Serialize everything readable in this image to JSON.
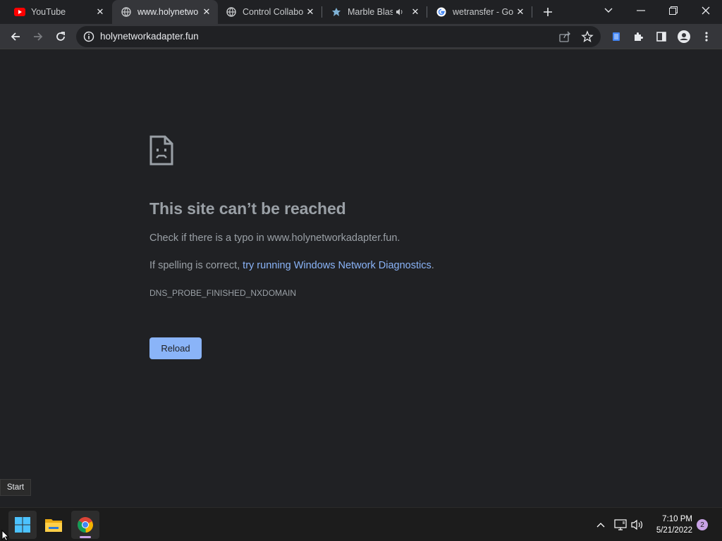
{
  "tabs": [
    {
      "title": "YouTube",
      "favicon": "youtube-icon"
    },
    {
      "title": "www.holynetwo",
      "favicon": "globe-icon"
    },
    {
      "title": "Control Collabo",
      "favicon": "globe-icon"
    },
    {
      "title": "Marble Blas",
      "favicon": "marble-icon"
    },
    {
      "title": "wetransfer - Go",
      "favicon": "google-icon"
    }
  ],
  "omnibox": {
    "url": "holynetworkadapter.fun"
  },
  "error": {
    "title": "This site can’t be reached",
    "line1": "Check if there is a typo in www.holynetworkadapter.fun.",
    "line2_prefix": "If spelling is correct, ",
    "line2_link": "try running Windows Network Diagnostics",
    "line2_suffix": ".",
    "code": "DNS_PROBE_FINISHED_NXDOMAIN",
    "reload_label": "Reload"
  },
  "tooltip": {
    "text": "Start"
  },
  "taskbar": {
    "time": "7:10 PM",
    "date": "5/21/2022",
    "notifications": "2"
  },
  "colors": {
    "background": "#202124",
    "toolbar": "#35363a",
    "link": "#8ab4f8",
    "button": "#8ab4f8",
    "text_muted": "#9aa0a6",
    "notification_badge": "#c9a3e6"
  }
}
